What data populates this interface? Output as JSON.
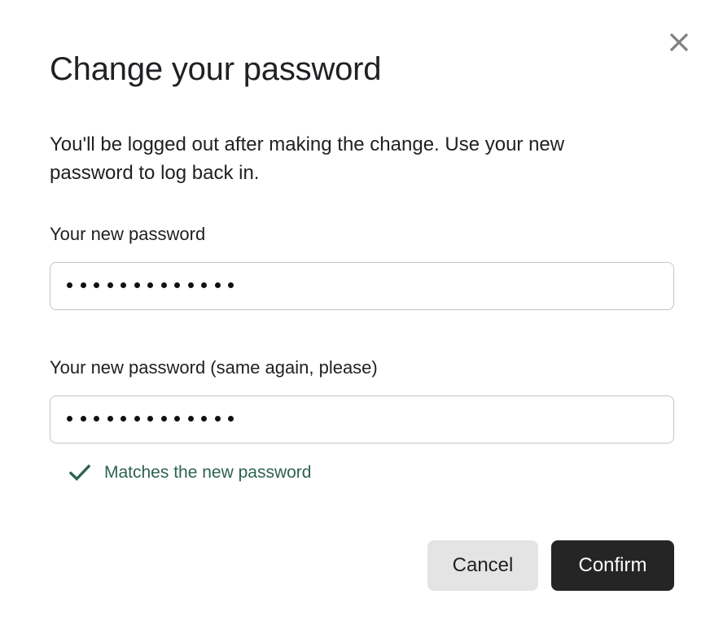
{
  "dialog": {
    "title": "Change your password",
    "description": "You'll be logged out after making the change. Use your new password to log back in.",
    "close_icon": "close-x-icon",
    "close_label": "Close"
  },
  "fields": [
    {
      "label": "Your new password",
      "value": "•••••••••••••",
      "masked_char_count": 13,
      "placeholder": "",
      "type": "password"
    },
    {
      "label": "Your new password (same again, please)",
      "value": "•••••••••••••",
      "masked_char_count": 13,
      "placeholder": "",
      "type": "password"
    }
  ],
  "validation": {
    "icon": "check-icon",
    "message": "Matches the new password",
    "state": "valid"
  },
  "actions": {
    "cancel_label": "Cancel",
    "confirm_label": "Confirm"
  },
  "colors": {
    "text": "#202124",
    "success": "#2d6350",
    "confirm_bg": "#252525",
    "confirm_text": "#ffffff",
    "cancel_bg": "#e4e4e4",
    "cancel_text": "#202124",
    "input_border": "#c6c6c6",
    "close_icon": "#808080",
    "background": "#ffffff"
  }
}
